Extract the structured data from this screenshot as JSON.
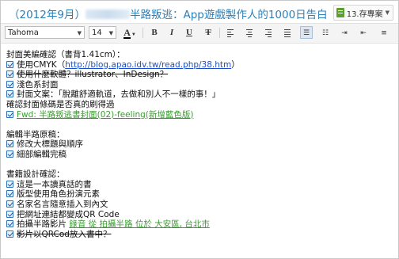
{
  "note": {
    "title_prefix": "（2012年9月）",
    "title_suffix": "半路叛逃：App遊戲製作人的1000日告白",
    "notebook": "13.存專案"
  },
  "toolbar": {
    "font_family": "Tahoma",
    "font_size": "14",
    "font_color_glyph": "A",
    "bold": "B",
    "italic": "I",
    "underline": "U",
    "strikethrough": "T"
  },
  "content": {
    "section1_heading": "封面美編確認（書背1.41cm）：",
    "s1_item1_prefix": "使用CMYK（",
    "s1_item1_link": "http://blog.apao.idv.tw/read.php/38.htm",
    "s1_item1_suffix": "）",
    "s1_item2_text": "使用什麼軟體？illustrator、",
    "s1_item2_strike": "InDesign",
    "s1_item2_end": "？",
    "s1_item3": "淺色系封面",
    "s1_item4": "封面文案：「脫離舒適軌道，去做和別人不一樣的事！」",
    "s1_note": "確認封面條碼是否真的刷得過",
    "s1_item5_link": "Fwd: 半路叛逃書封面(02)-feeling(新增藍色版)",
    "section2_heading": "編輯半路原稿：",
    "s2_item1": "修改大標題與順序",
    "s2_item2": "細部編輯完稿",
    "section3_heading": "書籍設計確認：",
    "s3_item1": "這是一本讀真話的書",
    "s3_item2": "版型使用角色扮演元素",
    "s3_item3": "名家名言隨意插入到內文",
    "s3_item4": "把網址連結都變成QR Code",
    "s3_item5_text": "拍攝半路影片 ",
    "s3_item5_link": "錄音 從 拍攝半路 位於 大安區, 台北市",
    "s3_item6": "影片以QRCod放入書中？"
  }
}
